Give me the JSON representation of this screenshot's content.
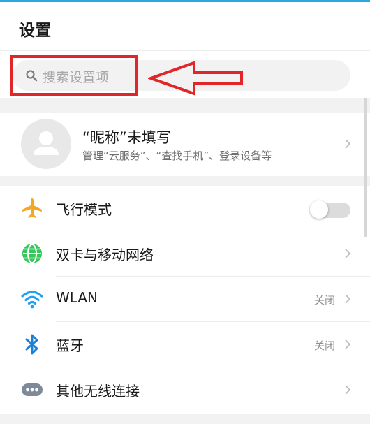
{
  "header": {
    "title": "设置"
  },
  "search": {
    "placeholder": "搜索设置项"
  },
  "account": {
    "name": "“昵称”未填写",
    "subtitle": "管理“云服务”、“查找手机”、登录设备等"
  },
  "list": {
    "airplane": {
      "label": "飞行模式",
      "icon": "airplane-icon",
      "enabled": false
    },
    "dual_sim": {
      "label": "双卡与移动网络",
      "icon": "globe-icon"
    },
    "wlan": {
      "label": "WLAN",
      "status": "关闭",
      "icon": "wifi-icon"
    },
    "bluetooth": {
      "label": "蓝牙",
      "status": "关闭",
      "icon": "bluetooth-icon"
    },
    "other_wireless": {
      "label": "其他无线连接",
      "icon": "more-dots-icon"
    }
  },
  "colors": {
    "accent": "#29a9e0",
    "airplane": "#f5a623",
    "network": "#34c759",
    "wifi": "#1ea1f1",
    "bluetooth": "#1e7fd8",
    "more": "#7e8a99",
    "annotation": "#e1262a"
  }
}
